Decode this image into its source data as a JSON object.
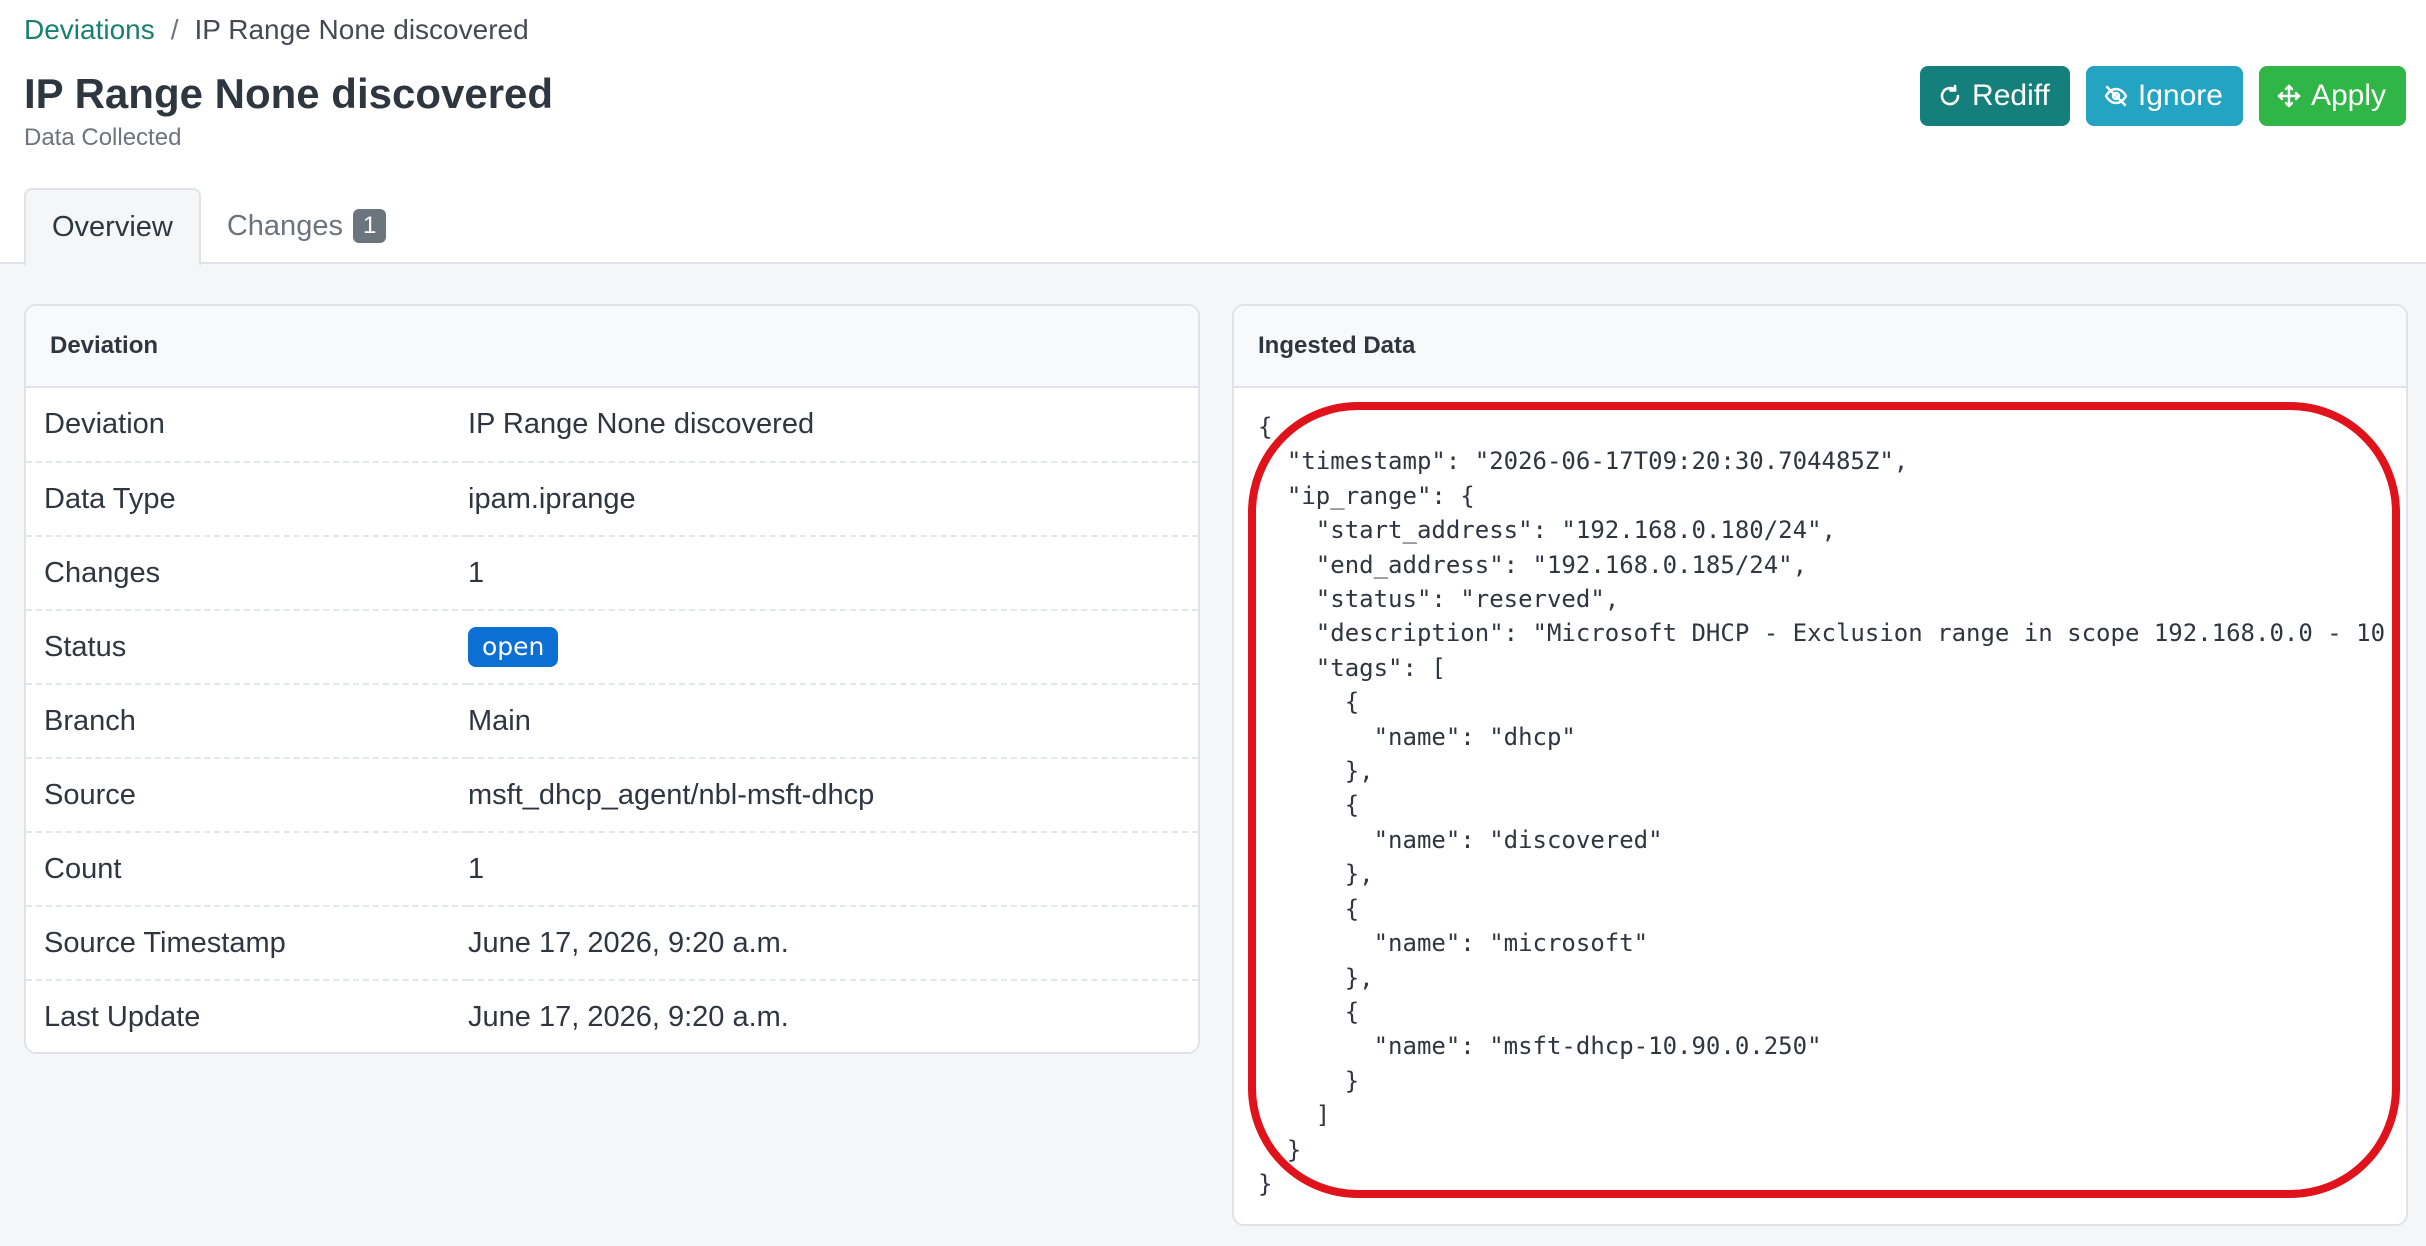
{
  "breadcrumb": {
    "parent": "Deviations",
    "separator": "/",
    "current": "IP Range None discovered"
  },
  "page": {
    "title": "IP Range None discovered",
    "subtitle": "Data Collected"
  },
  "actions": {
    "rediff": "Rediff",
    "ignore": "Ignore",
    "apply": "Apply"
  },
  "tabs": {
    "overview": "Overview",
    "changes": "Changes",
    "changes_count": "1"
  },
  "deviation_card": {
    "header": "Deviation",
    "rows": [
      {
        "key": "Deviation",
        "value": "IP Range None discovered"
      },
      {
        "key": "Data Type",
        "value": "ipam.iprange"
      },
      {
        "key": "Changes",
        "value": "1"
      },
      {
        "key": "Status",
        "value": "open"
      },
      {
        "key": "Branch",
        "value": "Main"
      },
      {
        "key": "Source",
        "value": "msft_dhcp_agent/nbl-msft-dhcp"
      },
      {
        "key": "Count",
        "value": "1"
      },
      {
        "key": "Source Timestamp",
        "value": "June 17, 2026, 9:20 a.m."
      },
      {
        "key": "Last Update",
        "value": "June 17, 2026, 9:20 a.m."
      }
    ]
  },
  "ingested_card": {
    "header": "Ingested Data",
    "json": "{\n  \"timestamp\": \"2026-06-17T09:20:30.704485Z\",\n  \"ip_range\": {\n    \"start_address\": \"192.168.0.180/24\",\n    \"end_address\": \"192.168.0.185/24\",\n    \"status\": \"reserved\",\n    \"description\": \"Microsoft DHCP - Exclusion range in scope 192.168.0.0 - 10\n    \"tags\": [\n      {\n        \"name\": \"dhcp\"\n      },\n      {\n        \"name\": \"discovered\"\n      },\n      {\n        \"name\": \"microsoft\"\n      },\n      {\n        \"name\": \"msft-dhcp-10.90.0.250\"\n      }\n    ]\n  }\n}"
  },
  "colors": {
    "link": "#19806f",
    "rediff": "#157f7c",
    "ignore": "#23a4c2",
    "apply": "#30b646",
    "status_open": "#0b6fd4",
    "annotation": "#e0121b"
  },
  "icons": {
    "rediff": "refresh-icon",
    "ignore": "eye-slash-icon",
    "apply": "move-arrows-icon"
  }
}
